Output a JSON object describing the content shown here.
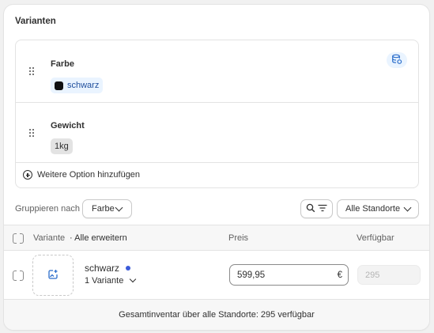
{
  "card": {
    "title": "Varianten"
  },
  "options": [
    {
      "name": "Farbe",
      "values": [
        {
          "label": "schwarz",
          "swatch": "#111111"
        }
      ]
    },
    {
      "name": "Gewicht",
      "values": [
        {
          "label": "1kg"
        }
      ]
    }
  ],
  "add_option_label": "Weitere Option hinzufügen",
  "toolbar": {
    "group_label": "Gruppieren nach",
    "group_value": "Farbe",
    "location_value": "Alle Standorte"
  },
  "table": {
    "col_variant": "Variante",
    "expand_all": "· Alle erweitern",
    "col_price": "Preis",
    "col_available": "Verfügbar",
    "rows": [
      {
        "name": "schwarz",
        "subcount": "1 Variante",
        "price": "599,95",
        "currency": "€",
        "available": "295"
      }
    ]
  },
  "footer": {
    "text": "Gesamtinventar über alle Standorte: 295 verfügbar"
  },
  "colors": {
    "accent": "#3b5bd9",
    "chip_bg": "#eaf4ff",
    "chip_text": "#1f4e9c"
  },
  "icons": [
    "drag-handle-icon",
    "database-icon",
    "plus-circle-icon",
    "search-icon",
    "filter-icon",
    "chevron-down-icon",
    "image-add-icon"
  ]
}
